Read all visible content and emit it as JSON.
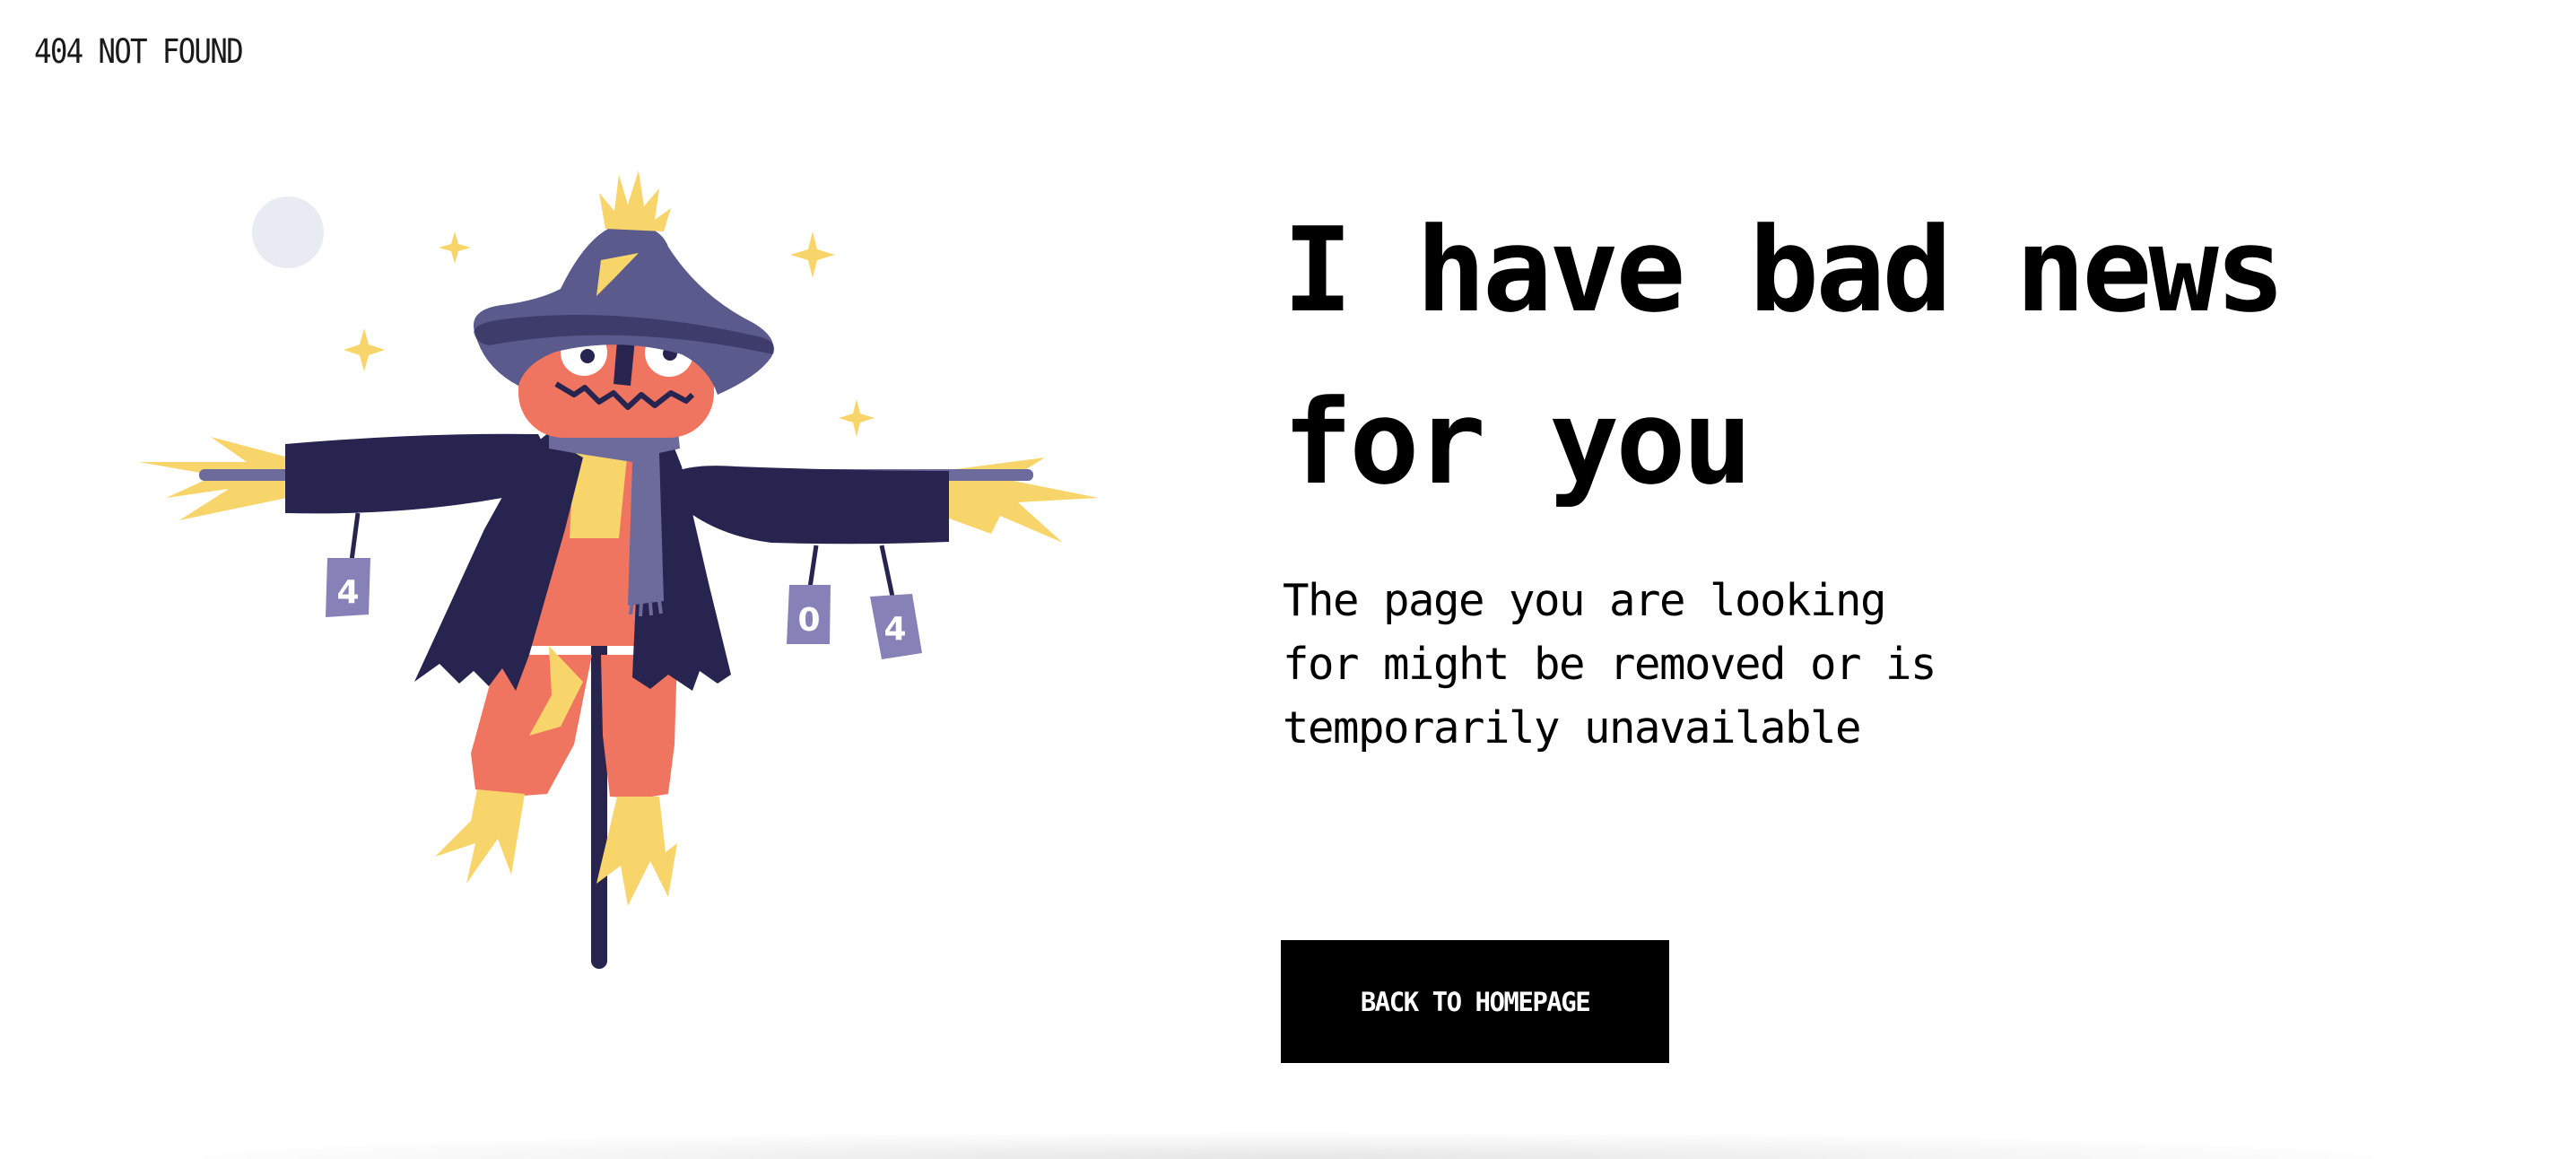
{
  "header": {
    "brand": "404 NOT FOUND"
  },
  "hero": {
    "headline": "I have bad news for you",
    "description": "The page you are looking for might be removed or is temporarily unavailable",
    "button_label": "BACK TO HOMEPAGE"
  },
  "illustration": {
    "subject": "scarecrow-illustration",
    "can_left_digit": "4",
    "can_middle_digit": "0",
    "can_right_digit": "4"
  },
  "colors": {
    "background": "#ffffff",
    "text": "#000000",
    "button_bg": "#000000",
    "button_text": "#ffffff",
    "scarecrow_coat": "#27254f",
    "scarecrow_hat": "#5b5a8c",
    "scarecrow_face": "#f07560",
    "straw": "#f8d56b",
    "cans": "#8682b8",
    "moon": "#e8ebf2"
  }
}
